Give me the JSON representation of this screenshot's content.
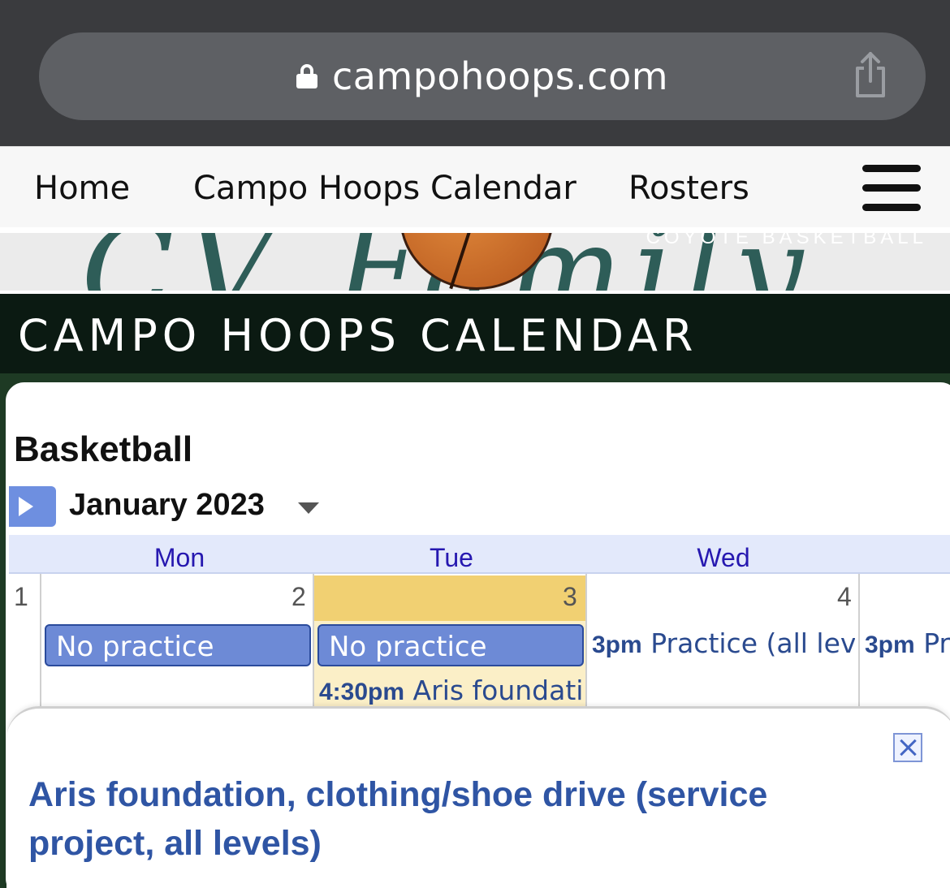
{
  "browser": {
    "url": "campohoops.com"
  },
  "nav": {
    "items": [
      {
        "label": "Home"
      },
      {
        "label": "Campo Hoops Calendar"
      },
      {
        "label": "Rosters"
      }
    ]
  },
  "banner": {
    "text": "CV Family",
    "top_text": "COYOTE BASKETBALL"
  },
  "page": {
    "title": "CAMPO HOOPS CALENDAR"
  },
  "calendar": {
    "name": "Basketball",
    "month": "January 2023",
    "days_of_week": [
      "Mon",
      "Tue",
      "Wed"
    ],
    "dates": [
      "1",
      "2",
      "3",
      "4"
    ],
    "events": {
      "mon_all_day": "No practice",
      "tue_all_day": "No practice",
      "tue_timed_time": "4:30pm",
      "tue_timed_title": "Aris foundati",
      "wed_timed_time": "3pm",
      "wed_timed_title": "Practice (all lev",
      "thu_timed_time": "3pm",
      "thu_timed_title": "Pr"
    },
    "colors": {
      "today": "#f1d072",
      "event": "#6d8ad6",
      "dow_text": "#2618b0"
    }
  },
  "popup": {
    "title": "Aris foundation, clothing/shoe drive (service project, all levels)"
  }
}
